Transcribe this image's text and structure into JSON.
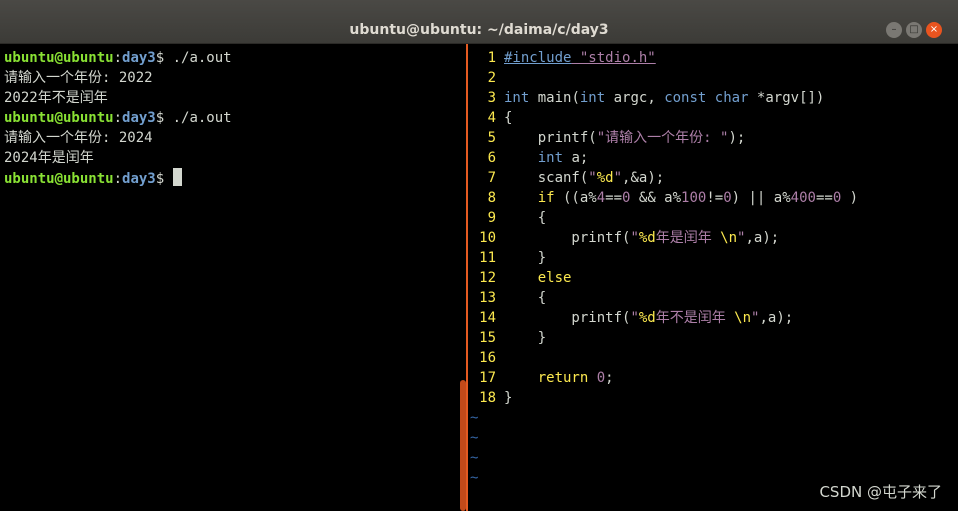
{
  "window": {
    "title": "ubuntu@ubuntu: ~/daima/c/day3",
    "min_label": "–",
    "max_label": "□",
    "close_label": "×"
  },
  "terminal": {
    "lines": [
      {
        "type": "prompt",
        "user": "ubuntu@ubuntu",
        "sep": ":",
        "dir": "day3",
        "cmd": "$ ./a.out"
      },
      {
        "type": "out",
        "text": "请输入一个年份: 2022"
      },
      {
        "type": "out",
        "text": "2022年不是闰年"
      },
      {
        "type": "prompt",
        "user": "ubuntu@ubuntu",
        "sep": ":",
        "dir": "day3",
        "cmd": "$ ./a.out"
      },
      {
        "type": "out",
        "text": "请输入一个年份: 2024"
      },
      {
        "type": "out",
        "text": "2024年是闰年"
      },
      {
        "type": "prompt",
        "user": "ubuntu@ubuntu",
        "sep": ":",
        "dir": "day3",
        "cmd": "$ "
      }
    ]
  },
  "editor": {
    "line_numbers": [
      "1",
      "2",
      "3",
      "4",
      "5",
      "6",
      "7",
      "8",
      "9",
      "10",
      "11",
      "12",
      "13",
      "14",
      "15",
      "16",
      "17",
      "18"
    ],
    "tilde": "~",
    "code": {
      "l1_pre": "#include",
      "l1_str": " \"stdio.h\"",
      "l3_int": "int",
      "l3_main": " main(",
      "l3_int2": "int",
      "l3_argc": " argc, ",
      "l3_const": "const",
      "l3_sp": " ",
      "l3_char": "char",
      "l3_rest": " *argv[])",
      "l4": "{",
      "l5_fn": "    printf(",
      "l5_str": "\"请输入一个年份: \"",
      "l5_end": ");",
      "l6_int": "int",
      "l6_rest": " a;",
      "l7_fn": "    scanf(",
      "l7_q1": "\"",
      "l7_fmt": "%d",
      "l7_q2": "\"",
      "l7_rest": ",&a);",
      "l8_if": "if",
      "l8_a": " ((a%",
      "l8_n4": "4",
      "l8_b": "==",
      "l8_n0a": "0",
      "l8_c": " && a%",
      "l8_n100": "100",
      "l8_d": "!=",
      "l8_n0b": "0",
      "l8_e": ") || a%",
      "l8_n400": "400",
      "l8_f": "==",
      "l8_n0c": "0",
      "l8_g": " )",
      "l9": "    {",
      "l10_fn": "        printf(",
      "l10_q1": "\"",
      "l10_fmt": "%d",
      "l10_txt": "年是闰年 ",
      "l10_esc": "\\n",
      "l10_q2": "\"",
      "l10_end": ",a);",
      "l11": "    }",
      "l12_else": "else",
      "l13": "    {",
      "l14_fn": "        printf(",
      "l14_q1": "\"",
      "l14_fmt": "%d",
      "l14_txt": "年不是闰年 ",
      "l14_esc": "\\n",
      "l14_q2": "\"",
      "l14_end": ",a);",
      "l15": "    }",
      "l17_ret": "return",
      "l17_sp": " ",
      "l17_num": "0",
      "l17_end": ";",
      "l18": "}"
    }
  },
  "watermark": "CSDN @屯子来了",
  "colors": {
    "prompt_user": "#8ae234",
    "prompt_dir": "#729fcf",
    "line_number": "#fce94f",
    "string": "#ad7fa8",
    "keyword": "#729fcf",
    "statement": "#fce94f",
    "tilde": "#3465a4",
    "accent": "#e45a21"
  }
}
